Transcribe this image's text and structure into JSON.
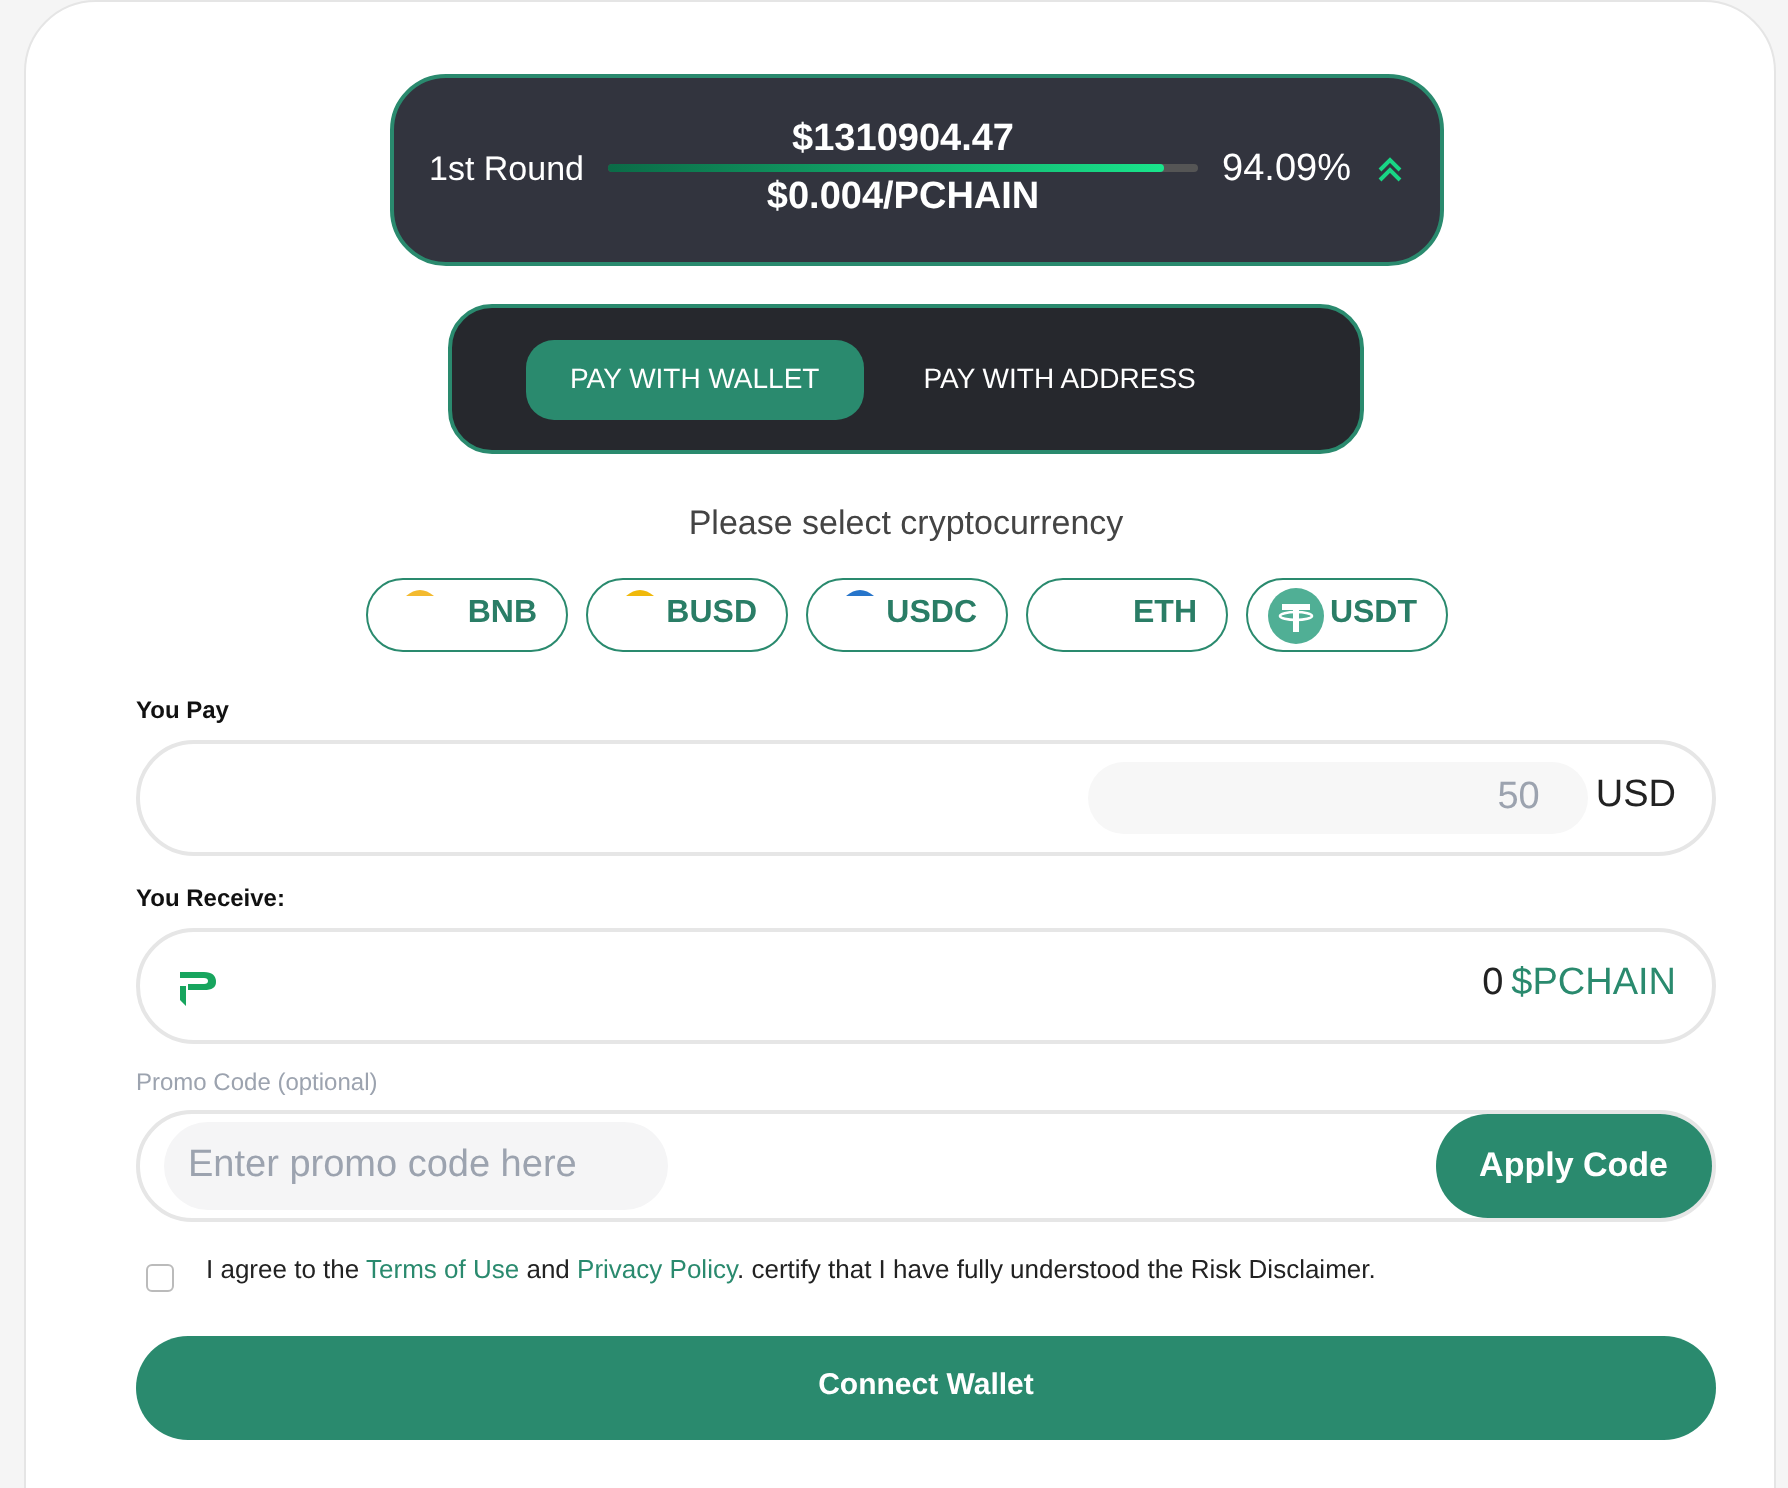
{
  "round": {
    "label": "1st Round",
    "raised": "$1310904.47",
    "price": "$0.004/PCHAIN",
    "level": 0.9409,
    "percent": "94.09%"
  },
  "pay_tabs": [
    {
      "label": "PAY WITH WALLET",
      "selected": true
    },
    {
      "label": "PAY WITH ADDRESS",
      "selected": false
    }
  ],
  "prompt": "Please select cryptocurrency",
  "currencies": [
    {
      "label": "BNB",
      "color": "#f3ba2f"
    },
    {
      "label": "BUSD",
      "color": "#f0b90b"
    },
    {
      "label": "USDC",
      "color": "#2775ca"
    },
    {
      "label": "ETH"
    },
    {
      "label": "USDT",
      "color": "#50af95"
    }
  ],
  "you_pay": {
    "label": "You Pay",
    "value": "50",
    "unit": "USD"
  },
  "you_receive": {
    "label": "You Receive:",
    "amount": "0",
    "unit": "$PCHAIN"
  },
  "promo": {
    "label": "Promo Code (optional)",
    "placeholder": "Enter promo code here",
    "button": "Apply Code"
  },
  "agree": {
    "checked": false,
    "parts": [
      {
        "kind": "text",
        "text": "I agree to the"
      },
      {
        "kind": "link",
        "text": "Terms of Use"
      },
      {
        "kind": "text",
        "text": "and"
      },
      {
        "kind": "link",
        "text": "Privacy Policy"
      },
      {
        "kind": "text",
        "text": ". certify that I have fully understood the Risk Disclaimer."
      }
    ]
  },
  "connect": "Connect Wallet"
}
